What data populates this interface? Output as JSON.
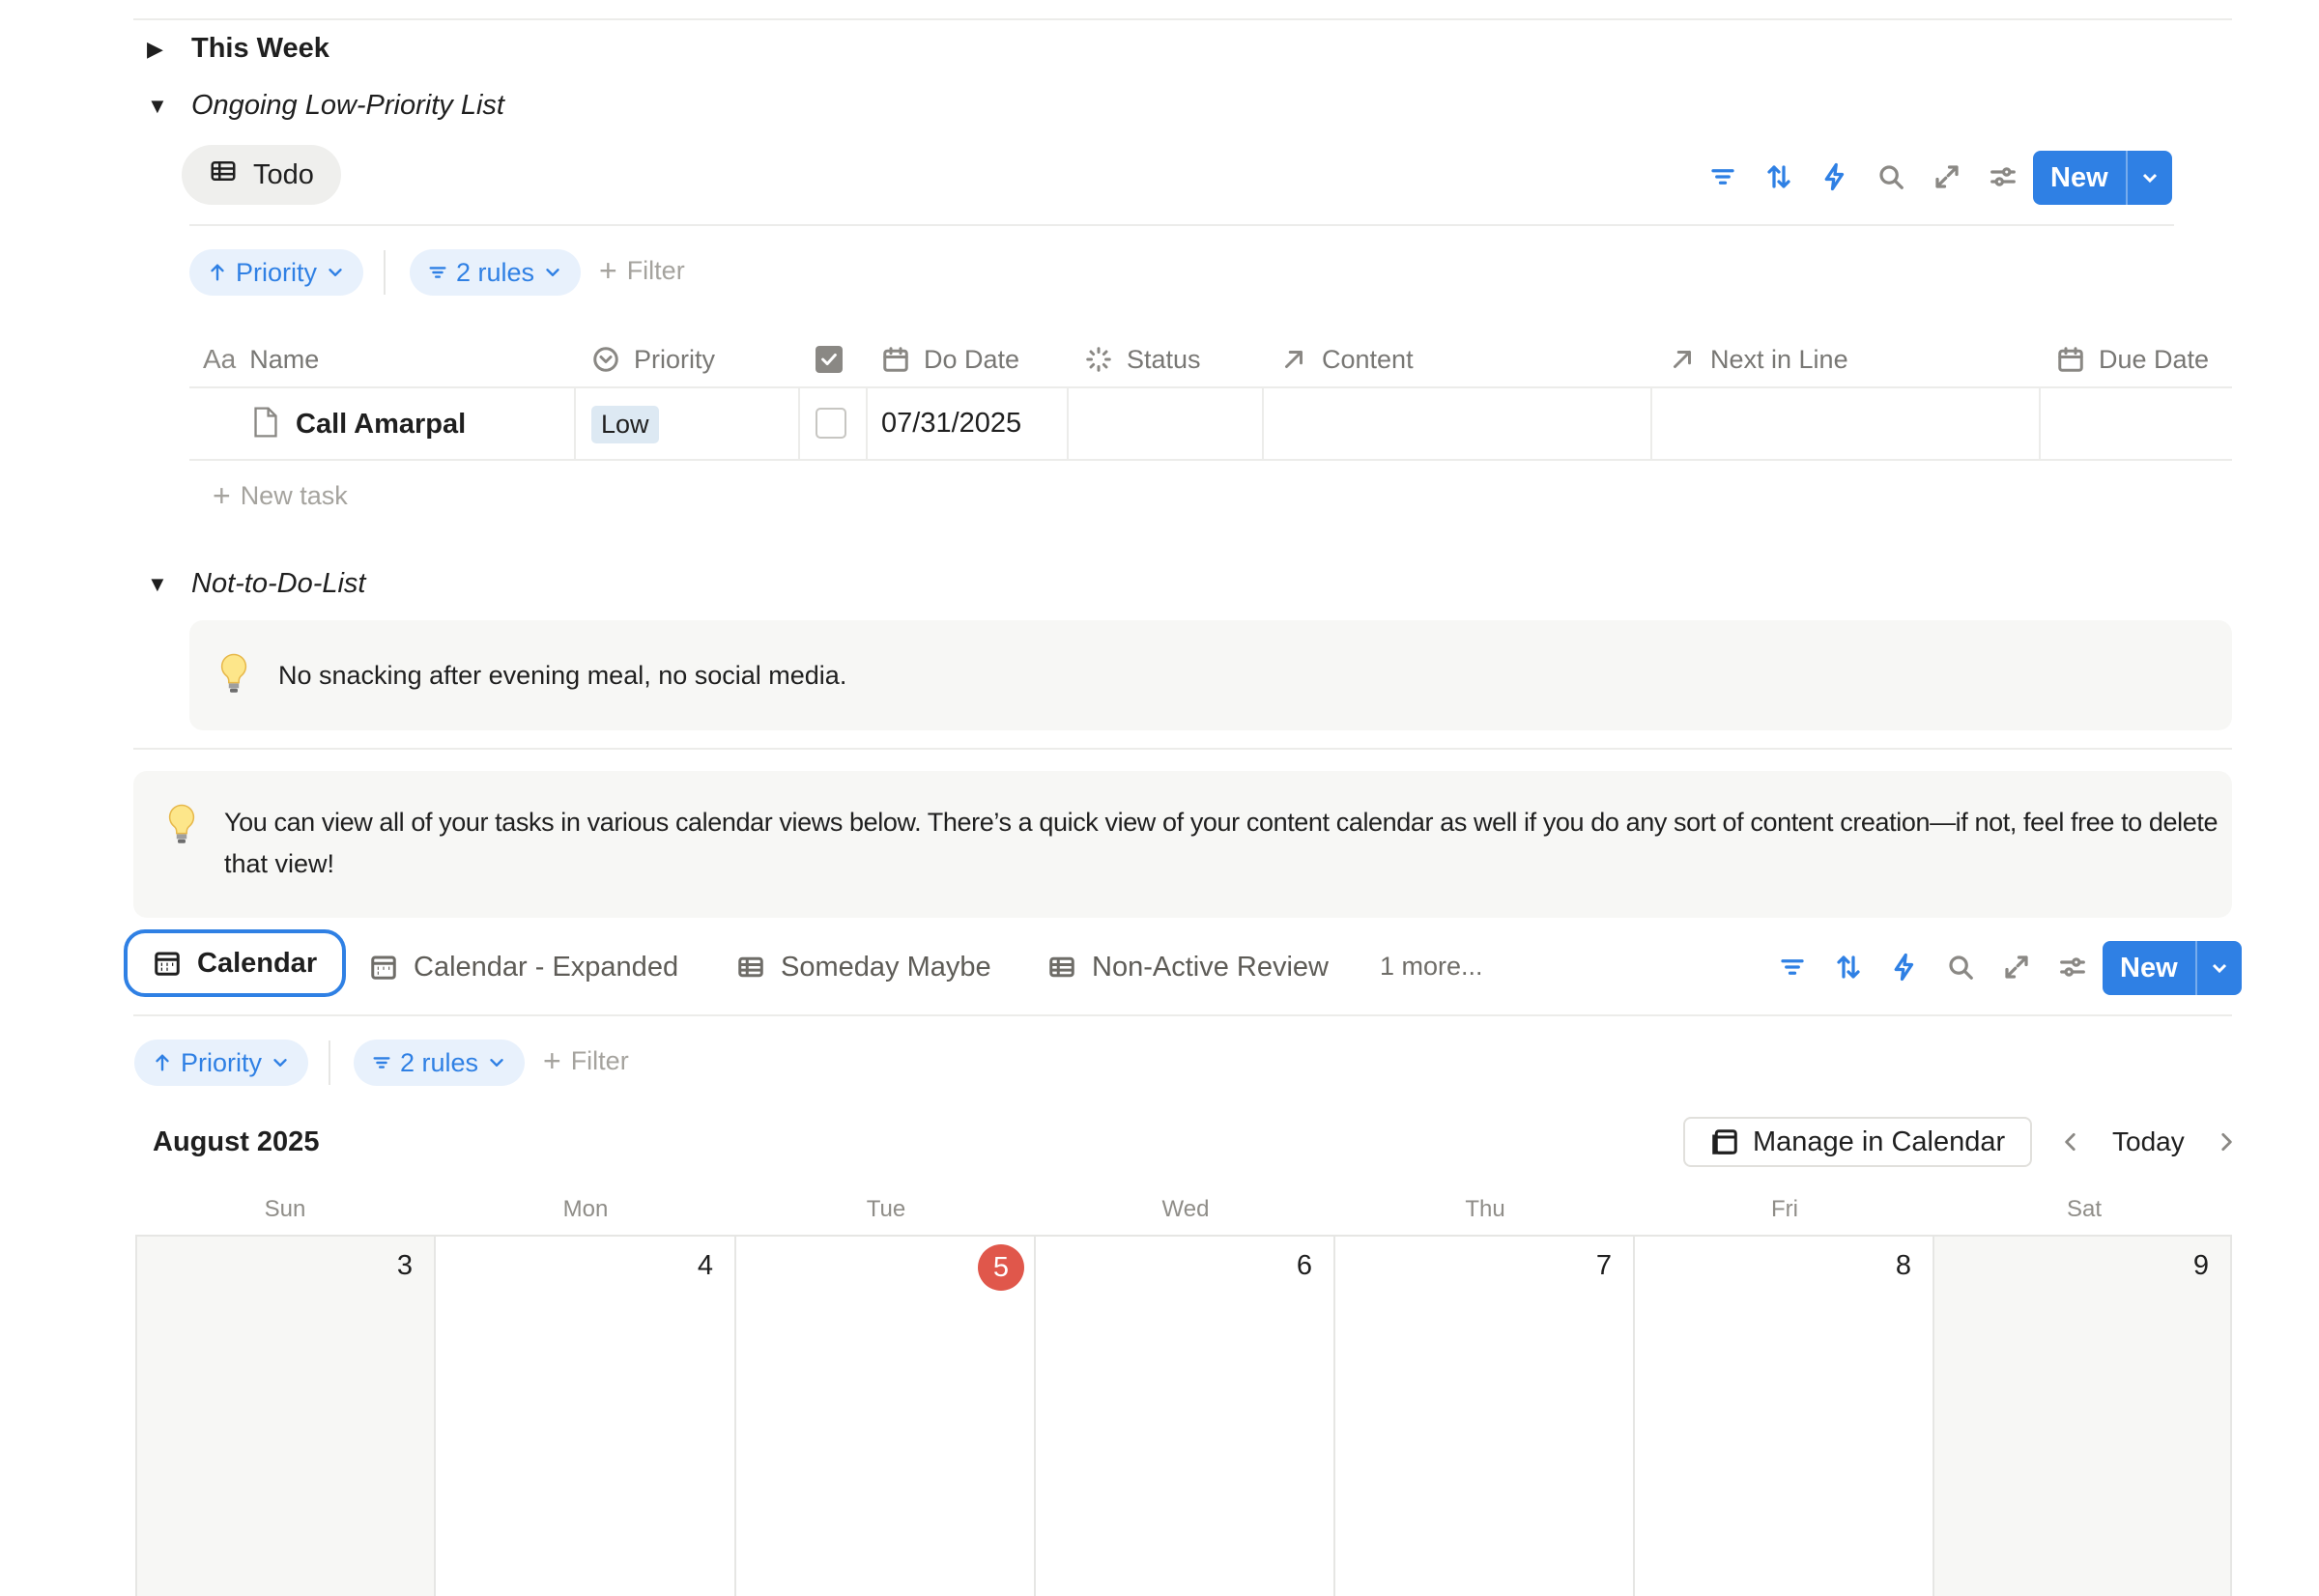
{
  "sections": {
    "this_week": "This Week",
    "low_priority": "Ongoing Low-Priority List",
    "not_to_do": "Not-to-Do-List"
  },
  "todo_view": {
    "tab_label": "Todo",
    "new_label": "New",
    "sort_chip": "Priority",
    "rules_chip": "2 rules",
    "add_filter": "Filter",
    "columns": [
      "Name",
      "Priority",
      "",
      "Do Date",
      "Status",
      "Content",
      "Next in Line",
      "Due Date"
    ],
    "rows": [
      {
        "name": "Call Amarpal",
        "priority": "Low",
        "checked": false,
        "do_date": "07/31/2025"
      }
    ],
    "new_task": "New task"
  },
  "callouts": {
    "not_to_do": "No snacking after evening meal, no social media.",
    "calendar_info_line1": "You can view all of your tasks in various calendar views below. There’s a quick view of your content calendar as well if you do any sort of content creation—if not, feel free to delete",
    "calendar_info_line2": "that view!"
  },
  "calendar_view": {
    "tabs": [
      "Calendar",
      "Calendar - Expanded",
      "Someday Maybe",
      "Non-Active Review"
    ],
    "more": "1 more...",
    "new_label": "New",
    "sort_chip": "Priority",
    "rules_chip": "2 rules",
    "add_filter": "Filter",
    "month": "August 2025",
    "manage_label": "Manage in Calendar",
    "today_label": "Today",
    "weekdays": [
      "Sun",
      "Mon",
      "Tue",
      "Wed",
      "Thu",
      "Fri",
      "Sat"
    ],
    "days": [
      "3",
      "4",
      "5",
      "6",
      "7",
      "8",
      "9"
    ],
    "today_index": 2
  },
  "colors": {
    "accent": "#2f80e4",
    "today_badge": "#e0574b",
    "priority_low": "#dde9f3"
  }
}
